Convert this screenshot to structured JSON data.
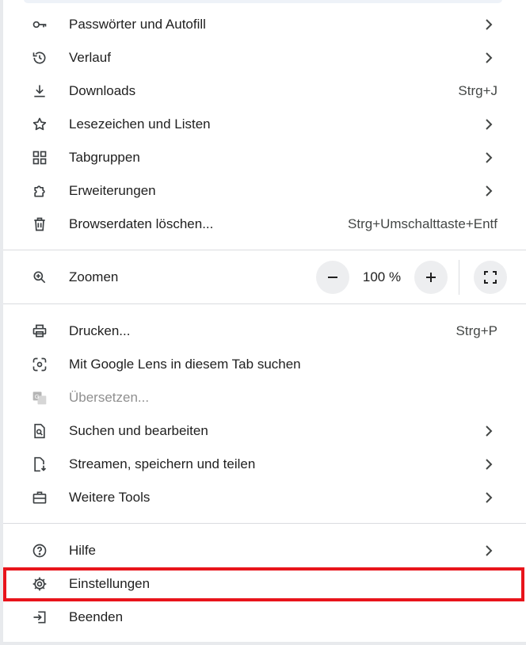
{
  "menu": {
    "items_top": [
      {
        "label": "Passwörter und Autofill",
        "icon": "key-icon",
        "chevron": true
      },
      {
        "label": "Verlauf",
        "icon": "history-icon",
        "chevron": true
      },
      {
        "label": "Downloads",
        "icon": "download-icon",
        "shortcut": "Strg+J"
      },
      {
        "label": "Lesezeichen und Listen",
        "icon": "star-icon",
        "chevron": true
      },
      {
        "label": "Tabgruppen",
        "icon": "tab-groups-icon",
        "chevron": true
      },
      {
        "label": "Erweiterungen",
        "icon": "extension-icon",
        "chevron": true
      },
      {
        "label": "Browserdaten löschen...",
        "icon": "trash-icon",
        "shortcut": "Strg+Umschalttaste+Entf"
      }
    ],
    "zoom": {
      "label": "Zoomen",
      "value": "100 %",
      "minus_icon": "minus-icon",
      "plus_icon": "plus-icon",
      "fullscreen_icon": "fullscreen-icon"
    },
    "items_mid": [
      {
        "label": "Drucken...",
        "icon": "print-icon",
        "shortcut": "Strg+P"
      },
      {
        "label": "Mit Google Lens in diesem Tab suchen",
        "icon": "google-lens-icon"
      },
      {
        "label": "Übersetzen...",
        "icon": "translate-icon",
        "disabled": true
      },
      {
        "label": "Suchen und bearbeiten",
        "icon": "find-edit-icon",
        "chevron": true
      },
      {
        "label": "Streamen, speichern und teilen",
        "icon": "save-share-icon",
        "chevron": true
      },
      {
        "label": "Weitere Tools",
        "icon": "toolbox-icon",
        "chevron": true
      }
    ],
    "items_bottom": [
      {
        "label": "Hilfe",
        "icon": "help-icon",
        "chevron": true
      },
      {
        "label": "Einstellungen",
        "icon": "gear-icon",
        "highlighted": true
      },
      {
        "label": "Beenden",
        "icon": "exit-icon"
      }
    ]
  },
  "colors": {
    "text": "#1f1f1f",
    "secondary_text": "#444746",
    "disabled_text": "#8f8f8f",
    "separator": "#dadce0",
    "zoom_button_bg": "#edeef0",
    "highlight_border": "#e8141b"
  }
}
